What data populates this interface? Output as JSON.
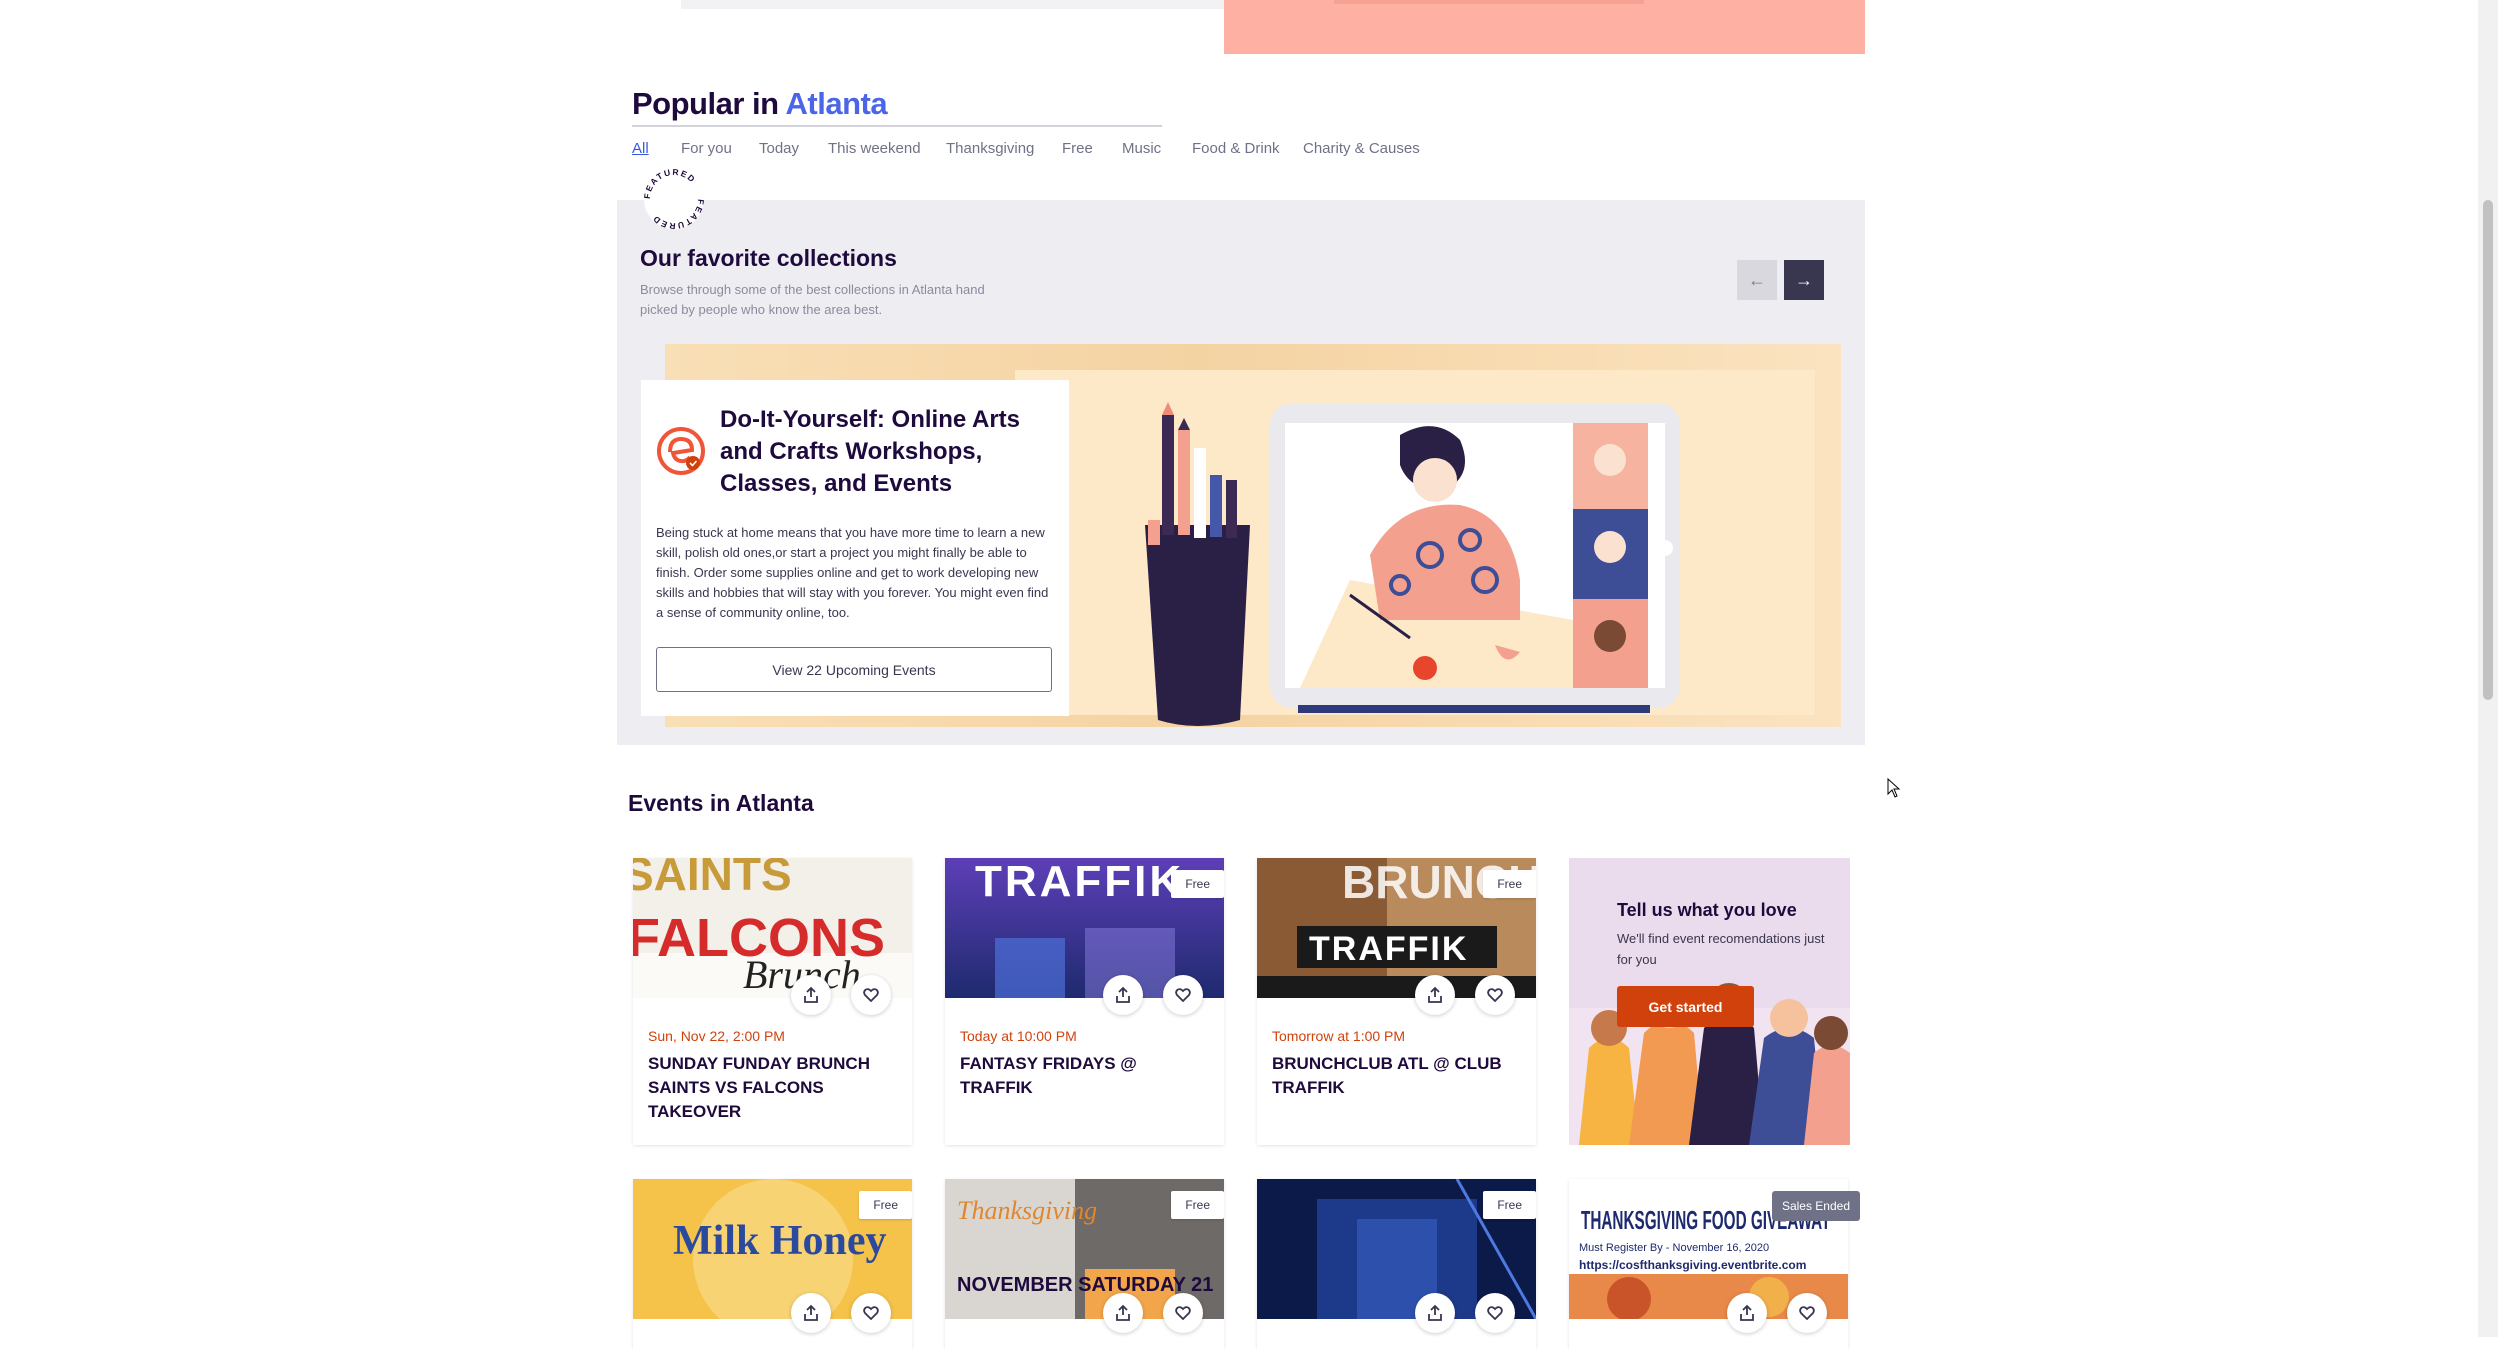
{
  "header": {
    "popular_prefix": "Popular in",
    "city": "Atlanta",
    "tabs": [
      "All",
      "For you",
      "Today",
      "This weekend",
      "Thanksgiving",
      "Free",
      "Music",
      "Food & Drink",
      "Charity & Causes"
    ],
    "active_tab": "All"
  },
  "collections": {
    "featured_badge": "FEATURED",
    "title": "Our favorite collections",
    "description": "Browse through some of the best collections in Atlanta hand picked by people who know the area best.",
    "prev_icon": "arrow-left-icon",
    "next_icon": "arrow-right-icon",
    "item": {
      "title": "Do-It-Yourself: Online Arts and Crafts Workshops, Classes, and Events",
      "description": "Being stuck at home means that you have more time to learn a new skill, polish old ones,or start a project you might finally be able to finish. Order some supplies online and get to work developing new skills and hobbies that will stay with you forever. You might even find a sense of community online, too.",
      "button_label": "View 22 Upcoming Events"
    }
  },
  "events": {
    "heading": "Events in Atlanta",
    "cards": [
      {
        "date": "Sun, Nov 22, 2:00 PM",
        "title": "SUNDAY FUNDAY BRUNCH SAINTS VS FALCONS TAKEOVER",
        "badge": "",
        "image_text": "FALCONS"
      },
      {
        "date": "Today at 10:00 PM",
        "title": "FANTASY FRIDAYS @ TRAFFIK",
        "badge": "Free",
        "image_text": "TRAFFIK"
      },
      {
        "date": "Tomorrow at 1:00 PM",
        "title": "BRUNCHCLUB ATL @ CLUB TRAFFIK",
        "badge": "Free",
        "image_text": "TRAFFIK"
      },
      {
        "date": "",
        "title": "",
        "badge": "Free",
        "image_text": "Milk Honey"
      },
      {
        "date": "",
        "title": "",
        "badge": "Free",
        "image_text": "NOVEMBER SATURDAY 21"
      },
      {
        "date": "",
        "title": "",
        "badge": "Free",
        "image_text": ""
      },
      {
        "date": "",
        "title": "",
        "badge": "Sales Ended",
        "image_text": "THANKSGIVING FOOD GIVEAWAY"
      }
    ],
    "promo": {
      "title": "Tell us what you love",
      "subtitle": "We'll find event recomendations just for you",
      "button_label": "Get started"
    }
  },
  "colors": {
    "accent_blue": "#4b65e8",
    "brand_orange": "#d1410c",
    "dark_text": "#1e0a3c",
    "muted_text": "#6f7287"
  }
}
